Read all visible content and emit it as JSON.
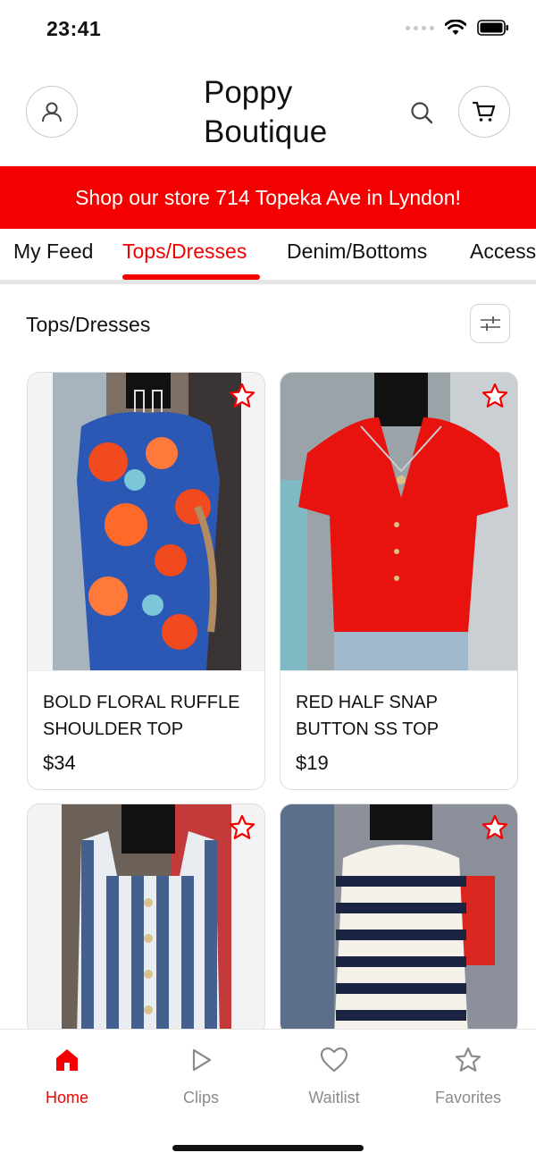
{
  "status": {
    "time": "23:41"
  },
  "header": {
    "brand_line1": "Poppy",
    "brand_line2": "Boutique",
    "icons": [
      "profile-icon",
      "search-icon",
      "cart-icon"
    ]
  },
  "promo": {
    "text": "Shop our store 714 Topeka Ave in Lyndon!"
  },
  "tabs": [
    {
      "label": "My Feed",
      "active": false
    },
    {
      "label": "Tops/Dresses",
      "active": true
    },
    {
      "label": "Denim/Bottoms",
      "active": false
    },
    {
      "label": "Access",
      "active": false
    }
  ],
  "section": {
    "title": "Tops/Dresses"
  },
  "products": [
    {
      "name": "BOLD FLORAL RUFFLE SHOULDER TOP",
      "price": "$34"
    },
    {
      "name": "RED HALF SNAP BUTTON SS TOP",
      "price": "$19"
    },
    {
      "name": "",
      "price": ""
    },
    {
      "name": "",
      "price": ""
    }
  ],
  "nav": [
    {
      "label": "Home",
      "icon": "home-icon",
      "active": true
    },
    {
      "label": "Clips",
      "icon": "play-icon",
      "active": false
    },
    {
      "label": "Waitlist",
      "icon": "heart-icon",
      "active": false
    },
    {
      "label": "Favorites",
      "icon": "star-icon",
      "active": false
    }
  ],
  "colors": {
    "accent": "#f40000",
    "muted": "#8b8b8b"
  }
}
